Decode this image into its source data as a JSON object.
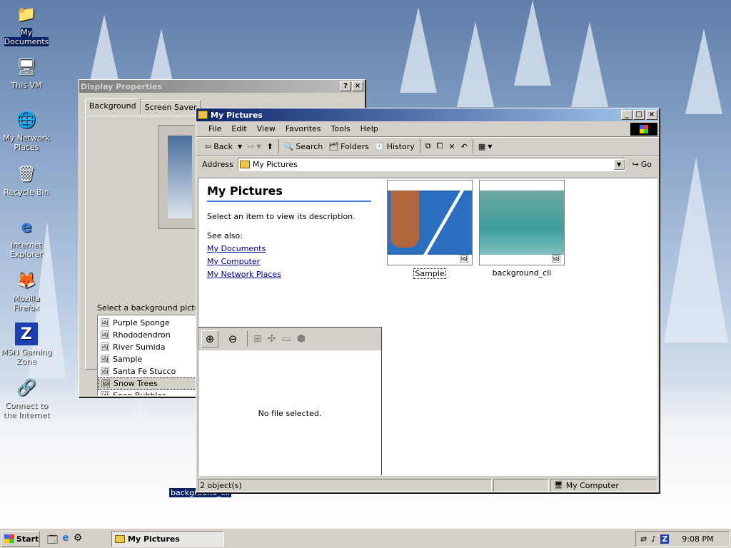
{
  "desktop_icons": [
    {
      "label": "My Documents",
      "icon": "folder-icon",
      "selected": true
    },
    {
      "label": "This VM",
      "icon": "computer-icon"
    },
    {
      "label": "My Network Places",
      "icon": "network-icon"
    },
    {
      "label": "Recycle Bin",
      "icon": "recycle-bin-icon"
    },
    {
      "label": "Internet Explorer",
      "icon": "ie-icon"
    },
    {
      "label": "Mozilla Firefox",
      "icon": "firefox-icon"
    },
    {
      "label": "MSN Gaming Zone",
      "icon": "msn-zone-icon"
    },
    {
      "label": "Connect to the Internet",
      "icon": "connect-icon"
    }
  ],
  "desktop_drag_label": "background_cli",
  "display_props": {
    "title": "Display Properties",
    "tabs": [
      "Background",
      "Screen Saver"
    ],
    "bg_label": "Select a background picture",
    "list": [
      "Purple Sponge",
      "Rhododendron",
      "River Sumida",
      "Sample",
      "Santa Fe Stucco",
      "Snow Trees",
      "Soap Bubbles"
    ],
    "selected_index": 5
  },
  "explorer": {
    "title": "My Pictures",
    "menu": [
      "File",
      "Edit",
      "View",
      "Favorites",
      "Tools",
      "Help"
    ],
    "toolbar": {
      "back": "Back",
      "search": "Search",
      "folders": "Folders",
      "history": "History"
    },
    "address_label": "Address",
    "address_value": "My Pictures",
    "go_label": "Go",
    "panel": {
      "heading": "My Pictures",
      "desc": "Select an item to view its description.",
      "see_also": "See also:",
      "links": [
        "My Documents",
        "My Computer",
        "My Network Places"
      ]
    },
    "preview_empty": "No file selected.",
    "files": [
      {
        "name": "Sample"
      },
      {
        "name": "background_cli"
      }
    ],
    "status": {
      "count": "2 object(s)",
      "zone": "My Computer"
    }
  },
  "taskbar": {
    "start": "Start",
    "task": "My Pictures",
    "time": "9:08 PM"
  },
  "colors": {
    "title_active": "#0a246a",
    "desktop_sky": "#5e7da8"
  }
}
